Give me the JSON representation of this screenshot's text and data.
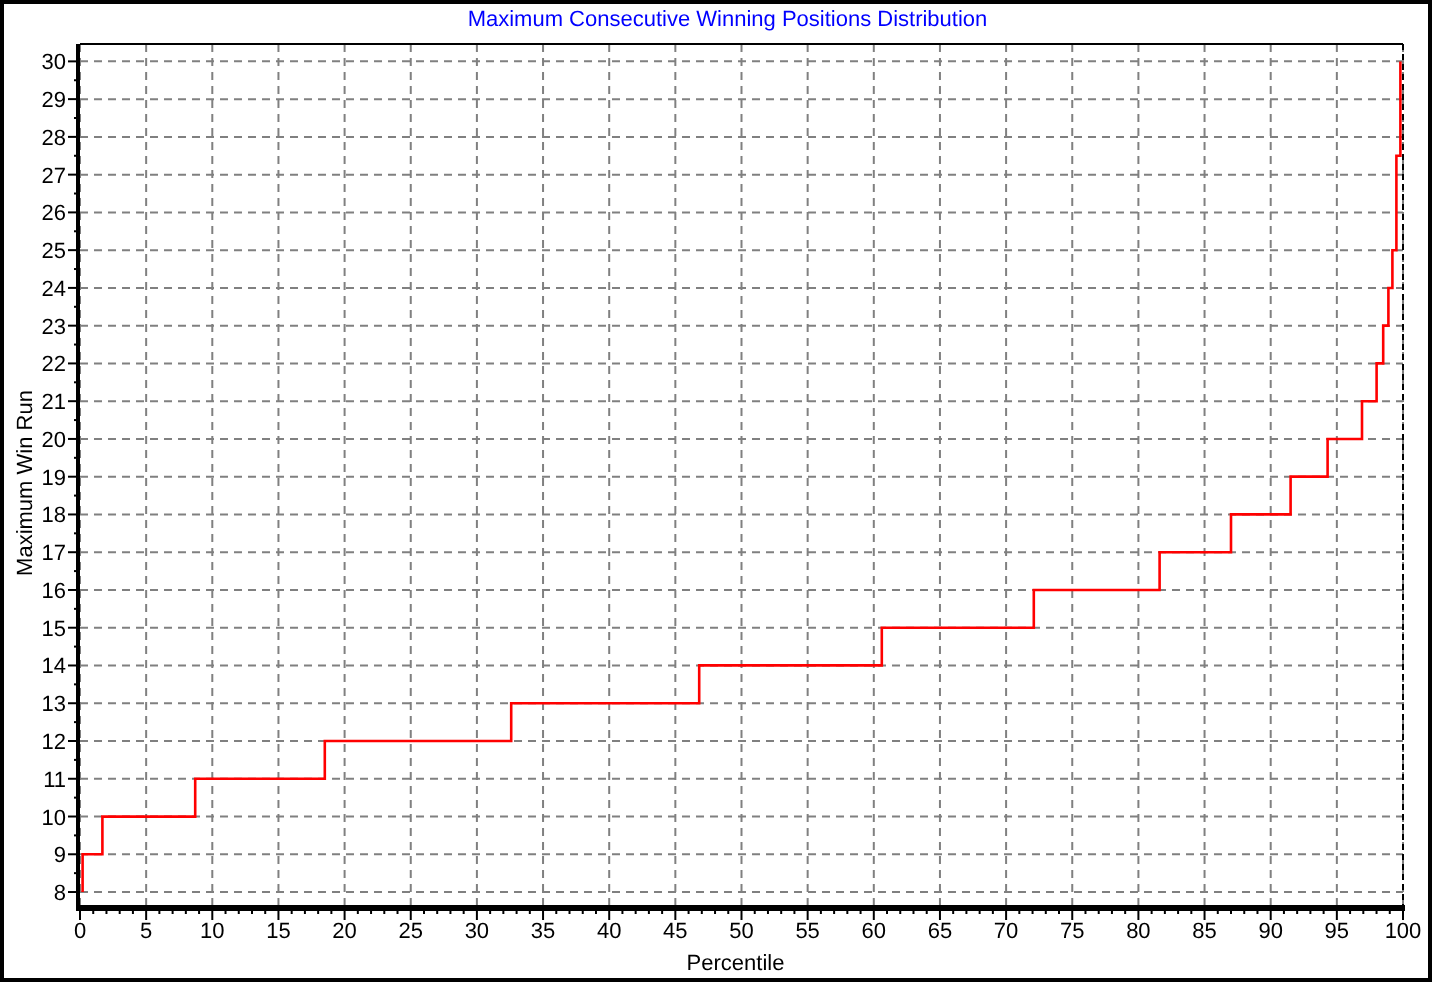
{
  "chart": {
    "chart_data": {
      "type": "line",
      "title": "Maximum Consecutive Winning Positions Distribution",
      "xlabel": "Percentile",
      "ylabel": "Maximum Win Run",
      "x": [
        0.2,
        0.2,
        1.7,
        1.7,
        8.7,
        8.7,
        18.5,
        18.5,
        32.6,
        32.6,
        46.8,
        46.8,
        60.6,
        60.6,
        72.1,
        72.1,
        81.6,
        81.6,
        87.0,
        87.0,
        91.5,
        91.5,
        94.3,
        94.3,
        96.9,
        96.9,
        98.0,
        98.0,
        98.5,
        98.5,
        98.9,
        98.9,
        99.2,
        99.2,
        99.5,
        99.5,
        99.8,
        99.8
      ],
      "series": [
        {
          "color": "#ff0000",
          "values": [
            8,
            9,
            9,
            10,
            10,
            11,
            11,
            12,
            12,
            13,
            13,
            14,
            14,
            15,
            15,
            16,
            16,
            17,
            17,
            18,
            18,
            19,
            19,
            20,
            20,
            21,
            21,
            22,
            22,
            23,
            23,
            24,
            24,
            25,
            25,
            27.5,
            27.5,
            30
          ]
        }
      ],
      "grid": true,
      "xlim": [
        0,
        100
      ],
      "ylim": [
        7.63,
        30.46
      ],
      "xticks": [
        0,
        5,
        10,
        15,
        20,
        25,
        30,
        35,
        40,
        45,
        50,
        55,
        60,
        65,
        70,
        75,
        80,
        85,
        90,
        95,
        100
      ],
      "yticks": [
        8,
        9,
        10,
        11,
        12,
        13,
        14,
        15,
        16,
        17,
        18,
        19,
        20,
        21,
        22,
        23,
        24,
        25,
        26,
        27,
        28,
        29,
        30
      ]
    }
  }
}
